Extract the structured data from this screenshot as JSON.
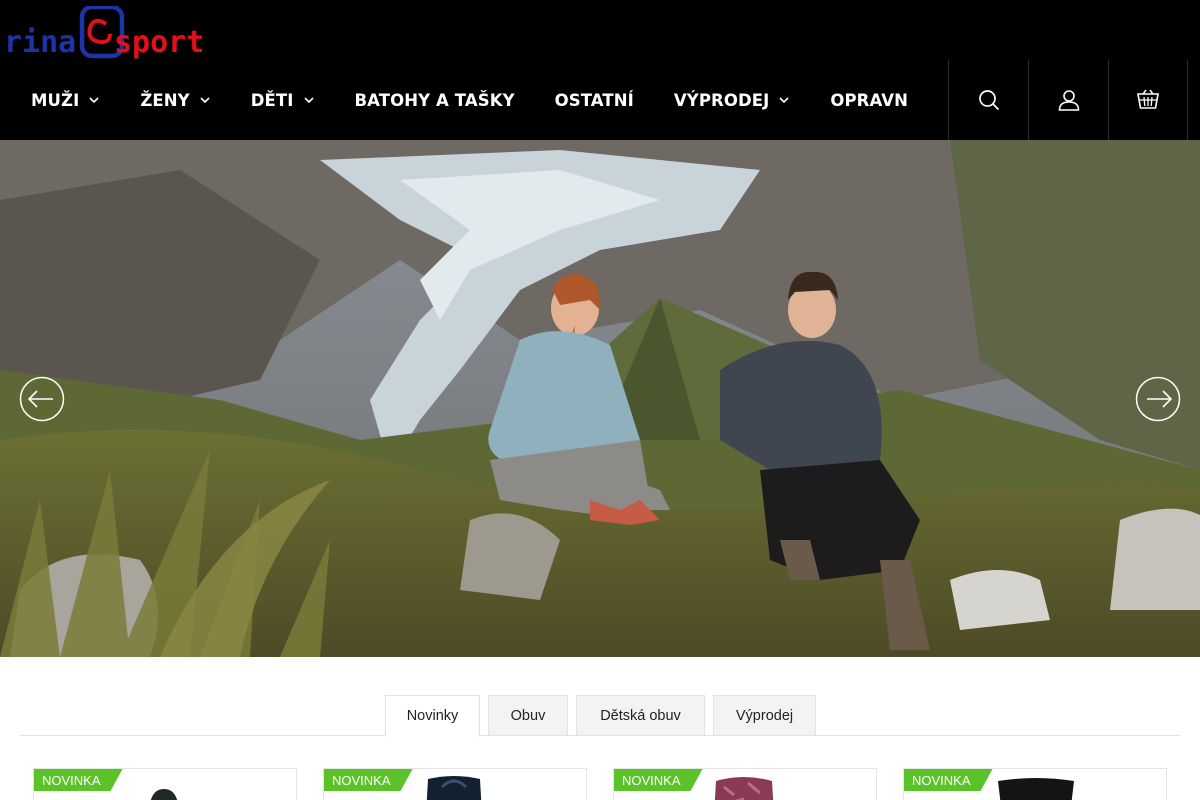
{
  "brand": {
    "logo_left": "rina",
    "logo_right": "sport",
    "colors": {
      "blue": "#1d33a8",
      "red": "#e3101b",
      "header_bg": "#000000",
      "badge_green": "#5cc22a"
    }
  },
  "nav": {
    "items": [
      {
        "label": "MUŽI",
        "has_dropdown": true
      },
      {
        "label": "ŽENY",
        "has_dropdown": true
      },
      {
        "label": "DĚTI",
        "has_dropdown": true
      },
      {
        "label": "BATOHY A TAŠKY",
        "has_dropdown": false
      },
      {
        "label": "OSTATNÍ",
        "has_dropdown": false
      },
      {
        "label": "VÝPRODEJ",
        "has_dropdown": true
      },
      {
        "label": "OPRAVN",
        "has_dropdown": false
      }
    ]
  },
  "header_icons": [
    "search-icon",
    "user-icon",
    "cart-icon"
  ],
  "hero": {
    "prev_icon": "arrow-left-icon",
    "next_icon": "arrow-right-icon"
  },
  "tabs": {
    "items": [
      {
        "label": "Novinky",
        "active": true
      },
      {
        "label": "Obuv",
        "active": false
      },
      {
        "label": "Dětská obuv",
        "active": false
      },
      {
        "label": "Výprodej",
        "active": false
      }
    ]
  },
  "products": [
    {
      "badge": "NOVINKA",
      "color": "#1f2a26"
    },
    {
      "badge": "NOVINKA",
      "color": "#13202f"
    },
    {
      "badge": "NOVINKA",
      "color": "#8a3a52"
    },
    {
      "badge": "NOVINKA",
      "color": "#141414"
    }
  ]
}
